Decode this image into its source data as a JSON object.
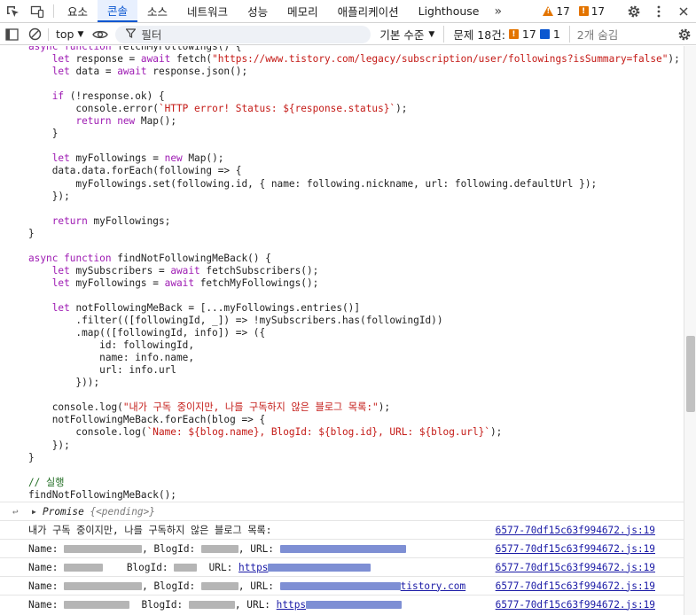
{
  "tabs": [
    "요소",
    "콘솔",
    "소스",
    "네트워크",
    "성능",
    "메모리",
    "애플리케이션",
    "Lighthouse"
  ],
  "active_tab": 1,
  "tab_more": "»",
  "warnings_count": "17",
  "errors_count": "17",
  "toolbar": {
    "context": "top",
    "filter_placeholder": "필터",
    "levels": "기본 수준",
    "issues_label": "문제 18건:",
    "issues_warn": "17",
    "issues_info": "1",
    "hidden": "2개 숨김"
  },
  "colors": {
    "accent": "#0b57d0",
    "warning": "#e37400",
    "keyword": "#9e1bb3",
    "string": "#c41a16"
  },
  "code_lines": [
    "async function fetchMyFollowings() {",
    "    let response = await fetch(\"https://www.tistory.com/legacy/subscription/user/followings?isSummary=false\");",
    "    let data = await response.json();",
    "",
    "    if (!response.ok) {",
    "        console.error(`HTTP error! Status: ${response.status}`);",
    "        return new Map();",
    "    }",
    "",
    "    let myFollowings = new Map();",
    "    data.data.forEach(following => {",
    "        myFollowings.set(following.id, { name: following.nickname, url: following.defaultUrl });",
    "    });",
    "",
    "    return myFollowings;",
    "}",
    "",
    "async function findNotFollowingMeBack() {",
    "    let mySubscribers = await fetchSubscribers();",
    "    let myFollowings = await fetchMyFollowings();",
    "",
    "    let notFollowingMeBack = [...myFollowings.entries()]",
    "        .filter(([followingId, _]) => !mySubscribers.has(followingId))",
    "        .map(([followingId, info]) => ({",
    "            id: followingId,",
    "            name: info.name,",
    "            url: info.url",
    "        }));",
    "",
    "    console.log(\"내가 구독 중이지만, 나를 구독하지 않은 블로그 목록:\");",
    "    notFollowingMeBack.forEach(blog => {",
    "        console.log(`Name: ${blog.name}, BlogId: ${blog.id}, URL: ${blog.url}`);",
    "    });",
    "}",
    "",
    "// 실행",
    "findNotFollowingMeBack();"
  ],
  "promise_label": "Promise",
  "promise_state": "{<pending>}",
  "log_header": "내가 구독 중이지만, 나를 구독하지 않은 블로그 목록:",
  "source_link": "6577-70df15c63f994672.js:19",
  "log_rows": [
    {
      "name_label": "Name:",
      "blogid_label": "BlogId:",
      "url_label": "URL:",
      "url_tail": ""
    },
    {
      "name_label": "Name:",
      "blogid_label": "BlogId:",
      "url_label": "URL:",
      "url_tail": "https"
    },
    {
      "name_label": "Name:",
      "blogid_label": "BlogId:",
      "url_label": "URL:",
      "url_tail": "tistory.com"
    },
    {
      "name_label": "Name:",
      "blogid_label": "BlogId:",
      "url_label": "URL:",
      "url_tail": "https"
    }
  ]
}
